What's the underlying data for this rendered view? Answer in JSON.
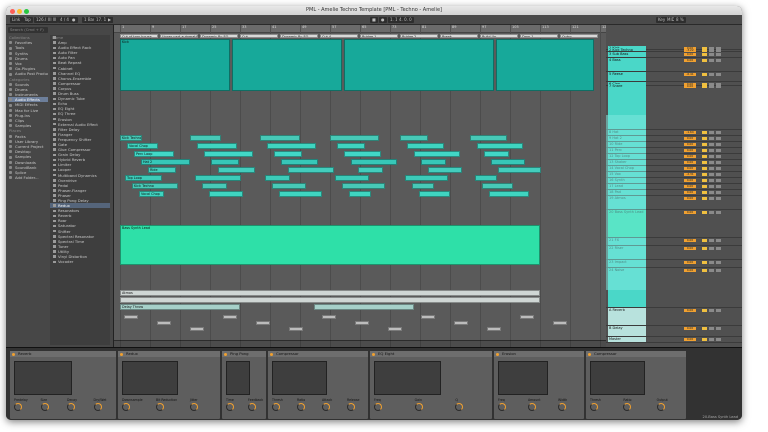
{
  "window": {
    "title": "PML - Amelie Techno Template  [PML - Techno - Amelie]"
  },
  "transport": {
    "items": [
      "Link",
      "Tap",
      "126.00",
      "III III",
      "4 / 4",
      "●",
      "1 Bar",
      "17. 1. 1",
      "▶",
      "■",
      "●",
      "1. 1. 1",
      "4. 0. 0",
      "Key",
      "MIDI",
      "8 %"
    ]
  },
  "browser": {
    "search_placeholder": "Search (Cmd + F)",
    "collections_header": "Collections",
    "collections": [
      "Favorites",
      "Tools",
      "Synths",
      "Drums",
      "Vox",
      "Go-Plugins",
      "Audio Post Produc"
    ],
    "categories_header": "Categories",
    "categories": [
      "Sounds",
      "Drums",
      "Instruments",
      "Audio Effects",
      "MIDI Effects",
      "Max for Live",
      "Plug-Ins",
      "Clips",
      "Samples"
    ],
    "places_header": "Places",
    "places": [
      "Packs",
      "User Library",
      "Current Project",
      "Desktop",
      "Samples",
      "Downloads",
      "SoundBank",
      "Splice",
      "Add Folder..."
    ],
    "name_header": "Name",
    "items": [
      "Amp",
      "Audio Effect Rack",
      "Auto Filter",
      "Auto Pan",
      "Beat Repeat",
      "Cabinet",
      "Channel EQ",
      "Chorus-Ensemble",
      "Compressor",
      "Corpus",
      "Drum Buss",
      "Dynamic Tube",
      "Echo",
      "EQ Eight",
      "EQ Three",
      "Erosion",
      "External Audio Effect",
      "Filter Delay",
      "Flanger",
      "Frequency Shifter",
      "Gate",
      "Glue Compressor",
      "Grain Delay",
      "Hybrid Reverb",
      "Limiter",
      "Looper",
      "Multiband Dynamics",
      "Overdrive",
      "Pedal",
      "Phaser-Flanger",
      "Phaser",
      "Ping Pong Delay",
      "Redux",
      "Resonators",
      "Reverb",
      "Roar",
      "Saturator",
      "Shifter",
      "Spectral Resonator",
      "Spectral Time",
      "Tuner",
      "Utility",
      "Vinyl Distortion",
      "Vocoder"
    ],
    "selected_item": "Redux"
  },
  "ruler": {
    "bars": [
      "1",
      "9",
      "17",
      "25",
      "33",
      "41",
      "49",
      "57",
      "65",
      "73",
      "81",
      "89",
      "97",
      "105",
      "113",
      "121",
      "129"
    ]
  },
  "locators": [
    "Cut of trap house",
    "Upper part automation",
    "Dynamic By EQ",
    "Cut",
    "Dynamic By EQ",
    "Cut 4",
    "Bridge 1",
    "Bridge 2",
    "Break",
    "Build Up",
    "Drop 1",
    "Outro"
  ],
  "arrangement": {
    "clips": [
      {
        "label": "Kick",
        "color": "#17a99a"
      },
      {
        "label": "Kick Techno",
        "color": "#47c9b7"
      },
      {
        "label": "Vocal Chop",
        "color": "#3fd4c0"
      },
      {
        "label": "Bass Synth Lead",
        "color": "#2ee0a8"
      },
      {
        "label": "Perc Loop",
        "color": "#41d7c6"
      },
      {
        "label": "Hat 2",
        "color": "#37c7b8"
      },
      {
        "label": "Ride",
        "color": "#43cdbd"
      },
      {
        "label": "Top Loop",
        "color": "#3ccbb9"
      },
      {
        "label": "Atmos",
        "color": "#cfd6d4"
      },
      {
        "label": "Delay Throw",
        "color": "#a6d0c9"
      }
    ]
  },
  "mixer": {
    "tracks": [
      {
        "name": "1 Kick",
        "vol": "0.00",
        "color": "#4ad7c8"
      },
      {
        "name": "2 Kick Techno",
        "vol": "-3.22",
        "color": "#4ad7c8"
      },
      {
        "name": "3 Sub Bass",
        "vol": "0.00",
        "color": "#4ad7c8"
      },
      {
        "name": "4 Bass",
        "vol": "0.00",
        "color": "#4ad7c8"
      },
      {
        "name": "5 Reese",
        "vol": "-6.41",
        "color": "#4ad7c8"
      },
      {
        "name": "6 Clap",
        "vol": "0.00",
        "color": "#4ad7c8"
      },
      {
        "name": "7 Snare",
        "vol": "0.00",
        "color": "#4ad7c8"
      },
      {
        "name": "8 Hat",
        "vol": "-1.64",
        "color": "#4ad7c8"
      },
      {
        "name": "9 Hat 2",
        "vol": "0.00",
        "color": "#4ad7c8"
      },
      {
        "name": "10 Ride",
        "vol": "0.00",
        "color": "#4ad7c8"
      },
      {
        "name": "11 Perc",
        "vol": "0.00",
        "color": "#4ad7c8"
      },
      {
        "name": "12 Top Loop",
        "vol": "0.00",
        "color": "#4ad7c8"
      },
      {
        "name": "13 Shaker",
        "vol": "0.00",
        "color": "#4ad7c8"
      },
      {
        "name": "14 Vocal Chop",
        "vol": "0.00",
        "color": "#4ad7c8"
      },
      {
        "name": "15 Vox",
        "vol": "-2.31",
        "color": "#4ad7c8"
      },
      {
        "name": "16 Synth",
        "vol": "0.00",
        "color": "#4ad7c8"
      },
      {
        "name": "17 Lead",
        "vol": "0.00",
        "color": "#4ad7c8"
      },
      {
        "name": "18 Pad",
        "vol": "0.00",
        "color": "#4ad7c8"
      },
      {
        "name": "19 Atmos",
        "vol": "0.00",
        "color": "#4ad7c8"
      },
      {
        "name": "20 Bass Synth Lead",
        "vol": "0.00",
        "color": "#2ee0a8"
      },
      {
        "name": "21 FX",
        "vol": "0.00",
        "color": "#4ad7c8"
      },
      {
        "name": "22 Riser",
        "vol": "0.00",
        "color": "#4ad7c8"
      },
      {
        "name": "23 Impact",
        "vol": "0.00",
        "color": "#4ad7c8"
      },
      {
        "name": "24 Noise",
        "vol": "0.00",
        "color": "#4ad7c8"
      },
      {
        "name": "A Reverb",
        "vol": "0.00",
        "color": "#b8e2dd"
      },
      {
        "name": "B Delay",
        "vol": "0.00",
        "color": "#b8e2dd"
      },
      {
        "name": "Master",
        "vol": "0.00",
        "color": "#b8e2dd"
      }
    ]
  },
  "devices": [
    {
      "name": "Reverb",
      "params": [
        "Predelay",
        "Size",
        "Decay",
        "Dry/Wet"
      ]
    },
    {
      "name": "Redux",
      "params": [
        "Downsample",
        "Bit Reduction",
        "Jitter"
      ]
    },
    {
      "name": "Ping Pong",
      "params": [
        "Time",
        "Feedback"
      ]
    },
    {
      "name": "Compressor",
      "params": [
        "Thresh",
        "Ratio",
        "Attack",
        "Release"
      ]
    },
    {
      "name": "EQ Eight",
      "params": [
        "Freq",
        "Gain",
        "Q"
      ]
    },
    {
      "name": "Erosion",
      "params": [
        "Freq",
        "Amount",
        "Width"
      ]
    },
    {
      "name": "Compressor",
      "params": [
        "Thresh",
        "Ratio",
        "Output"
      ]
    }
  ],
  "status": {
    "text": "20-Bass Synth Lead"
  }
}
